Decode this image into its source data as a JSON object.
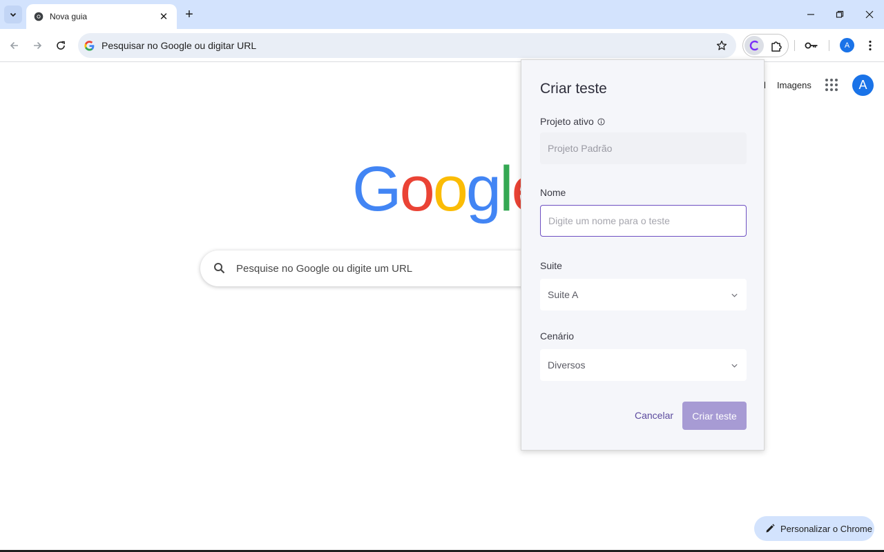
{
  "browser": {
    "tab": {
      "title": "Nova guia",
      "favicon": "chrome-icon",
      "close": "✕"
    },
    "new_tab": "+",
    "window": {
      "minimize": "minimize-icon",
      "restore": "restore-icon",
      "close": "close-icon"
    },
    "toolbar": {
      "back": "back-arrow-icon",
      "forward": "forward-arrow-icon",
      "reload": "reload-icon",
      "omnibox_text": "Pesquisar no Google ou digitar URL",
      "bookmark": "star-icon",
      "profile_initial": "A"
    }
  },
  "page": {
    "top_links": {
      "gmail_partial": "l",
      "images": "Imagens"
    },
    "avatar_initial": "A",
    "logo_letters": [
      "G",
      "o",
      "o",
      "g",
      "l",
      "e"
    ],
    "logo_colors": [
      "#4285f4",
      "#ea4335",
      "#fbbc05",
      "#4285f4",
      "#34a853",
      "#ea4335"
    ],
    "search_placeholder": "Pesquise no Google ou digite um URL",
    "customize_label": "Personalizar o Chrome"
  },
  "popup": {
    "title": "Criar teste",
    "active_project": {
      "label": "Projeto ativo",
      "value": "Projeto Padrão"
    },
    "name": {
      "label": "Nome",
      "placeholder": "Digite um nome para o teste"
    },
    "suite": {
      "label": "Suite",
      "value": "Suite A"
    },
    "scenario": {
      "label": "Cenário",
      "value": "Diversos"
    },
    "cancel_label": "Cancelar",
    "create_label": "Criar teste",
    "accent_color": "#6d4fc2"
  }
}
